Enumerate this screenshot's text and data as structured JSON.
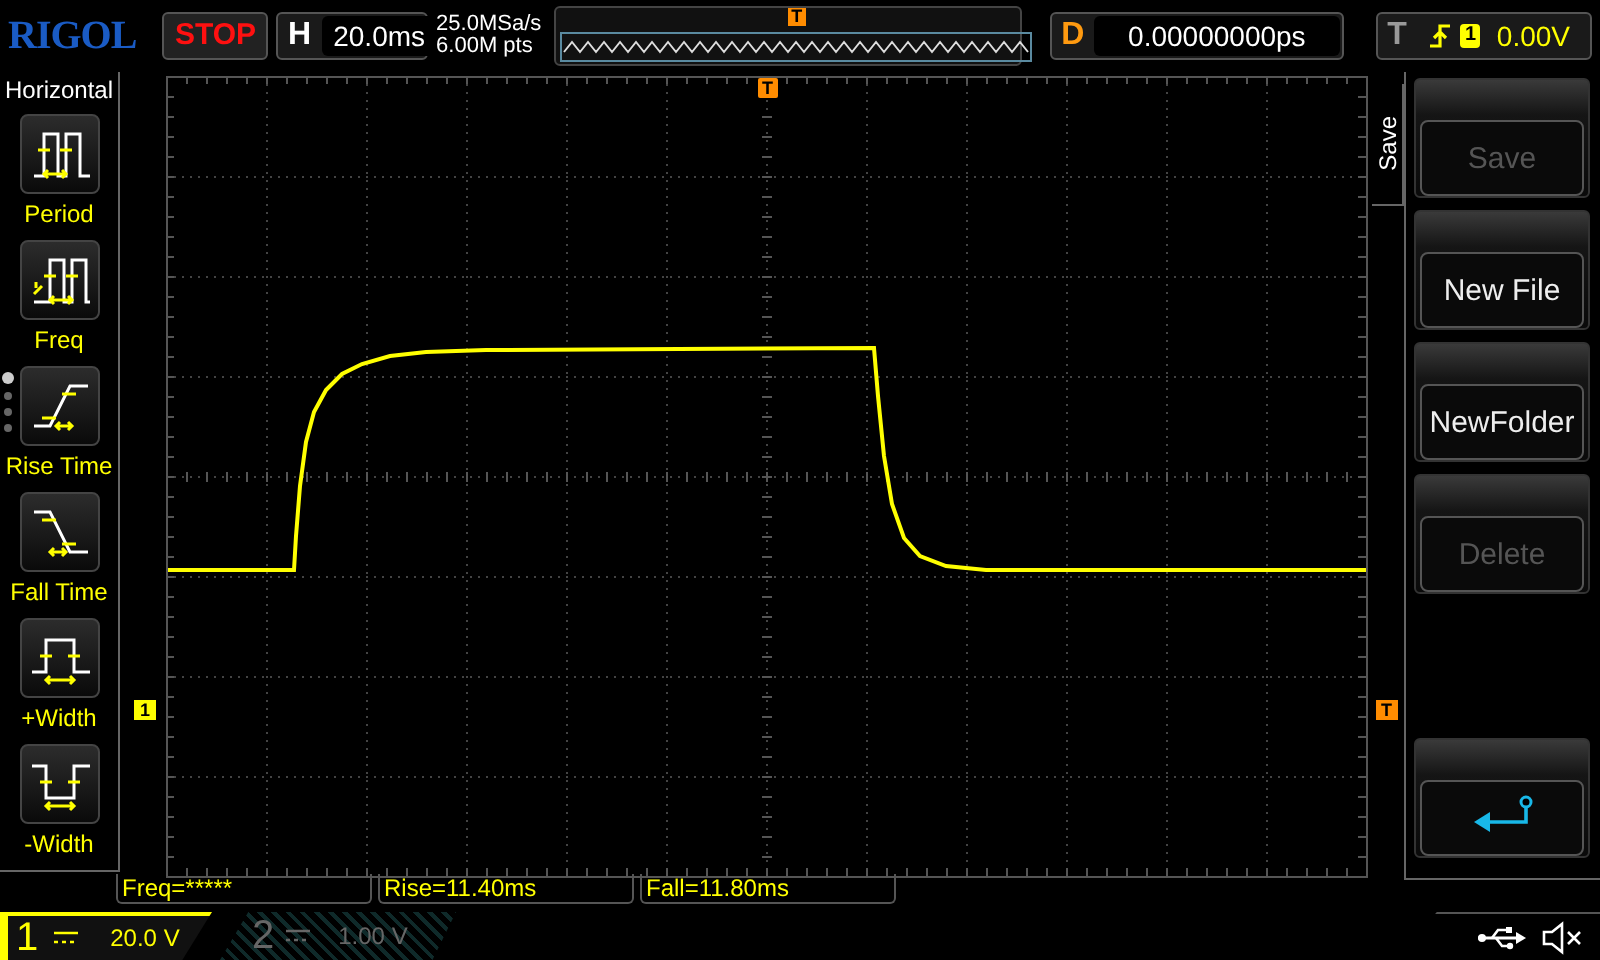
{
  "brand": {
    "logo": "RIGOL"
  },
  "run_state": {
    "label": "STOP",
    "kind": "stopped"
  },
  "timebase": {
    "key": "H",
    "value": "20.0ms"
  },
  "acquisition": {
    "sample_rate": "25.0MSa/s",
    "memory_depth": "6.00M pts"
  },
  "overview": {
    "trigger_marker": "T"
  },
  "delay": {
    "key": "D",
    "value": "0.00000000ps"
  },
  "trigger": {
    "key": "T",
    "source": "1",
    "level": "0.00V"
  },
  "left_menu": {
    "title": "Horizontal",
    "page_dots": [
      {
        "selected": true
      },
      {
        "selected": false
      },
      {
        "selected": false
      },
      {
        "selected": false
      }
    ],
    "items": [
      {
        "label": "Period",
        "kind": "period"
      },
      {
        "label": "Freq",
        "kind": "freq"
      },
      {
        "label": "Rise Time",
        "kind": "rise"
      },
      {
        "label": "Fall Time",
        "kind": "fall"
      },
      {
        "label": "+Width",
        "kind": "pwidth"
      },
      {
        "label": "-Width",
        "kind": "nwidth"
      }
    ]
  },
  "markers": {
    "trigger_position": "T",
    "channel": "1",
    "trigger_level": "T"
  },
  "measurements": [
    "Freq=*****",
    "Rise=11.40ms",
    "Fall=11.80ms"
  ],
  "channels": [
    {
      "number": "1",
      "scale": "20.0 V",
      "on": true
    },
    {
      "number": "2",
      "scale": "1.00 V",
      "on": false
    }
  ],
  "right_menu": {
    "title": "Save",
    "buttons": [
      {
        "kind": "text",
        "label": "Save",
        "disabled": true
      },
      {
        "kind": "text",
        "label": "New File",
        "disabled": false
      },
      {
        "kind": "text",
        "label": "NewFolder",
        "disabled": false
      },
      {
        "kind": "text",
        "label": "Delete",
        "disabled": true
      },
      {
        "kind": "back"
      }
    ]
  }
}
